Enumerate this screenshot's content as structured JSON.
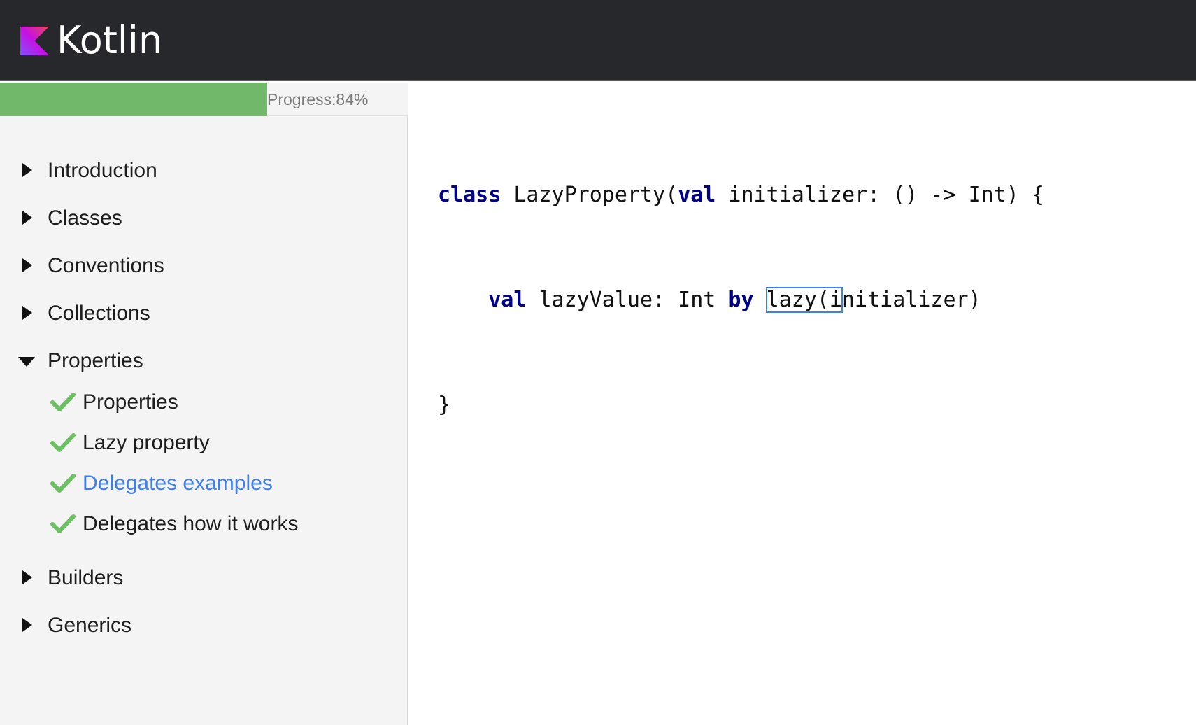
{
  "header": {
    "brand": "Kotlin"
  },
  "progress": {
    "label": "Progress:84%",
    "percent": 84
  },
  "sidebar": {
    "sections": [
      {
        "label": "Introduction",
        "expanded": false
      },
      {
        "label": "Classes",
        "expanded": false
      },
      {
        "label": "Conventions",
        "expanded": false
      },
      {
        "label": "Collections",
        "expanded": false
      },
      {
        "label": "Properties",
        "expanded": true,
        "children": [
          {
            "label": "Properties",
            "completed": true
          },
          {
            "label": "Lazy property",
            "completed": true
          },
          {
            "label": "Delegates examples",
            "completed": true,
            "active": true
          },
          {
            "label": "Delegates how it works",
            "completed": true
          }
        ]
      },
      {
        "label": "Builders",
        "expanded": false
      },
      {
        "label": "Generics",
        "expanded": false
      }
    ]
  },
  "editor": {
    "line1": {
      "kw1": "class",
      "t1": " LazyProperty(",
      "kw2": "val",
      "t2": " initializer: () -> Int) {"
    },
    "line2": {
      "indent": "    ",
      "kw1": "val",
      "t1": " lazyValue: Int ",
      "kw2": "by",
      "t2": " ",
      "hl1": "lazy(i",
      "t3": "nitializer)"
    },
    "line3": {
      "t1": "}"
    }
  },
  "colors": {
    "header_bg": "#27282c",
    "progress_fill": "#72b86a",
    "active_link": "#3d7ff0",
    "keyword": "#00008b",
    "check": "#6cbf63"
  }
}
